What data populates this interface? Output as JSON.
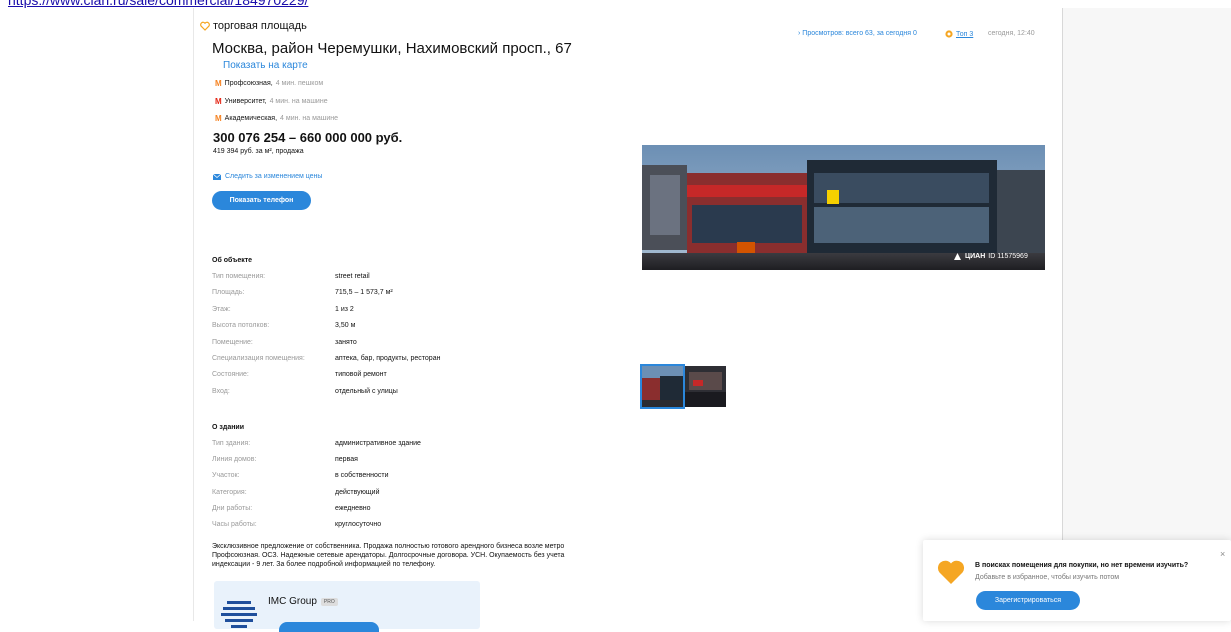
{
  "url_text": "https://www.cian.ru/sale/commercial/184970229/",
  "listing": {
    "type_label": "торговая площадь",
    "address": "Москва, район Черемушки, Нахимовский просп., 67",
    "map_link": "Показать на карте",
    "metro": [
      {
        "name": "Профсоюзная,",
        "distance": "4 мин. пешком",
        "color": "#f58220"
      },
      {
        "name": "Университет,",
        "distance": "4 мин. на машине",
        "color": "#e42313"
      },
      {
        "name": "Академическая,",
        "distance": "4 мин. на машине",
        "color": "#f58220"
      }
    ],
    "price": "300 076 254 – 660 000 000 руб.",
    "price_sub": "419 394 руб. за м², продажа",
    "follow_price": "Следить за изменением цены",
    "phone_button": "Показать телефон"
  },
  "about_object": {
    "title": "Об объекте",
    "rows": [
      {
        "label": "Тип помещения:",
        "value": "street retail"
      },
      {
        "label": "Площадь:",
        "value": "715,5 – 1 573,7 м²"
      },
      {
        "label": "Этаж:",
        "value": "1 из 2"
      },
      {
        "label": "Высота потолков:",
        "value": "3,50 м"
      },
      {
        "label": "Помещение:",
        "value": "занято"
      },
      {
        "label": "Специализация помещения:",
        "value": "аптека, бар, продукты, ресторан"
      },
      {
        "label": "Состояние:",
        "value": "типовой ремонт"
      },
      {
        "label": "Вход:",
        "value": "отдельный с улицы"
      }
    ]
  },
  "about_building": {
    "title": "О здании",
    "rows": [
      {
        "label": "Тип здания:",
        "value": "административное здание"
      },
      {
        "label": "Линия домов:",
        "value": "первая"
      },
      {
        "label": "Участок:",
        "value": "в собственности"
      },
      {
        "label": "Категория:",
        "value": "действующий"
      },
      {
        "label": "Дни работы:",
        "value": "ежедневно"
      },
      {
        "label": "Часы работы:",
        "value": "круглосуточно"
      }
    ]
  },
  "description": "Эксклюзивное предложение от собственника. Продажа полностью готового арендного бизнеса возле метро Профсоюзная. ОСЗ. Надежные сетевые арендаторы. Долгосрочные договора. УСН. Окупаемость без учета индексации - 9 лет. За более подробной информацией по телефону.",
  "agent": {
    "name": "IMC Group",
    "badge": "PRO"
  },
  "stats": {
    "views": "Просмотров: всего 63, за сегодня 0",
    "top": "Топ 3",
    "time": "сегодня, 12:40"
  },
  "photo": {
    "watermark_brand": "ЦИАН",
    "watermark_id": "ID 11575969"
  },
  "popup": {
    "text_bold": "В поисках помещения для покупки, но нет времени изучить?",
    "text_hint": "Добавьте в избранное, чтобы изучить потом",
    "button": "Зарегистрироваться",
    "close": "×"
  },
  "colors": {
    "accent": "#2b87db",
    "favorite": "#f5a623",
    "metro_orange": "#f58220",
    "metro_red": "#e42313"
  }
}
